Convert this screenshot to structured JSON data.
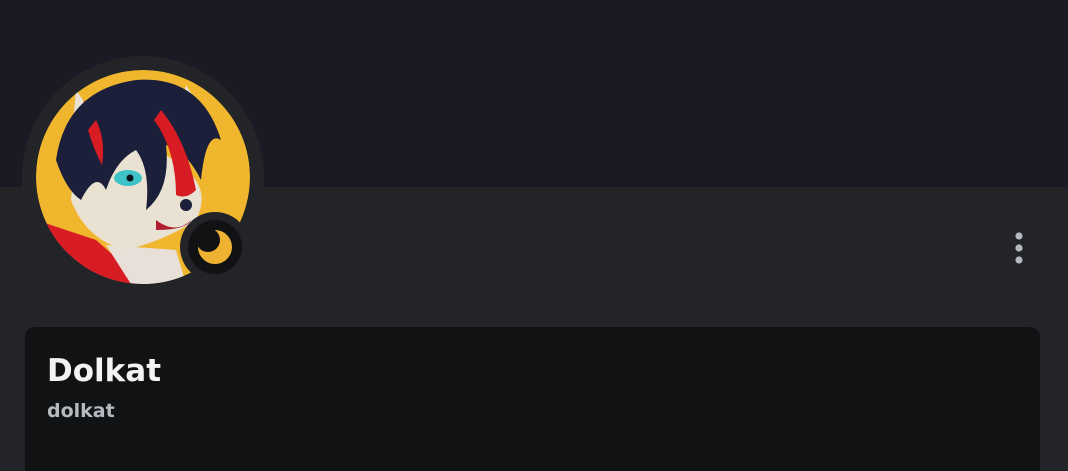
{
  "profile": {
    "display_name": "Dolkat",
    "username": "dolkat",
    "avatar_icon": "avatar-portrait",
    "status": "idle",
    "status_icon": "crescent-moon-icon"
  },
  "menu": {
    "more_icon": "more-vertical-icon"
  },
  "colors": {
    "banner": "#1b1a24",
    "background": "#232428",
    "card": "#111214",
    "idle_status": "#f0b232",
    "display_name": "#f2f3f5",
    "username": "#b5bac1"
  }
}
